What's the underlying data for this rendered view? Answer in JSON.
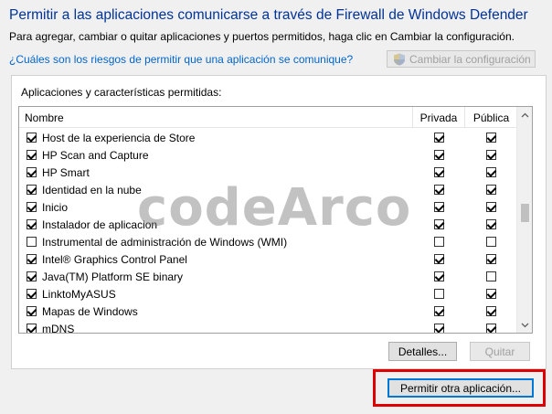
{
  "title": "Permitir a las aplicaciones comunicarse a través de Firewall de Windows Defender",
  "subtitle": "Para agregar, cambiar o quitar aplicaciones y puertos permitidos, haga clic en Cambiar la configuración.",
  "risk_link": "¿Cuáles son los riesgos de permitir que una aplicación se comunique?",
  "change_settings_label": "Cambiar la configuración",
  "group_label": "Aplicaciones y características permitidas:",
  "columns": {
    "name": "Nombre",
    "private": "Privada",
    "public": "Pública"
  },
  "apps": [
    {
      "name": "Host de la experiencia de Store",
      "enabled": true,
      "private": true,
      "public": true
    },
    {
      "name": "HP Scan and Capture",
      "enabled": true,
      "private": true,
      "public": true
    },
    {
      "name": "HP Smart",
      "enabled": true,
      "private": true,
      "public": true
    },
    {
      "name": "Identidad en la nube",
      "enabled": true,
      "private": true,
      "public": true
    },
    {
      "name": "Inicio",
      "enabled": true,
      "private": true,
      "public": true
    },
    {
      "name": "Instalador de aplicacion",
      "enabled": true,
      "private": true,
      "public": true
    },
    {
      "name": "Instrumental de administración de Windows (WMI)",
      "enabled": false,
      "private": false,
      "public": false
    },
    {
      "name": "Intel® Graphics Control Panel",
      "enabled": true,
      "private": true,
      "public": true
    },
    {
      "name": "Java(TM) Platform SE binary",
      "enabled": true,
      "private": true,
      "public": false
    },
    {
      "name": "LinktoMyASUS",
      "enabled": true,
      "private": false,
      "public": true
    },
    {
      "name": "Mapas de Windows",
      "enabled": true,
      "private": true,
      "public": true
    },
    {
      "name": "mDNS",
      "enabled": true,
      "private": true,
      "public": true
    }
  ],
  "details_label": "Detalles...",
  "remove_label": "Quitar",
  "allow_other_label": "Permitir otra aplicación...",
  "watermark": "codeArco",
  "colors": {
    "title": "#003399",
    "link": "#0066cc",
    "highlight": "#e00000",
    "accent": "#0078d7"
  },
  "icons": {
    "shield": "uac-shield-icon",
    "scroll_up": "chevron-up-icon",
    "scroll_down": "chevron-down-icon"
  }
}
